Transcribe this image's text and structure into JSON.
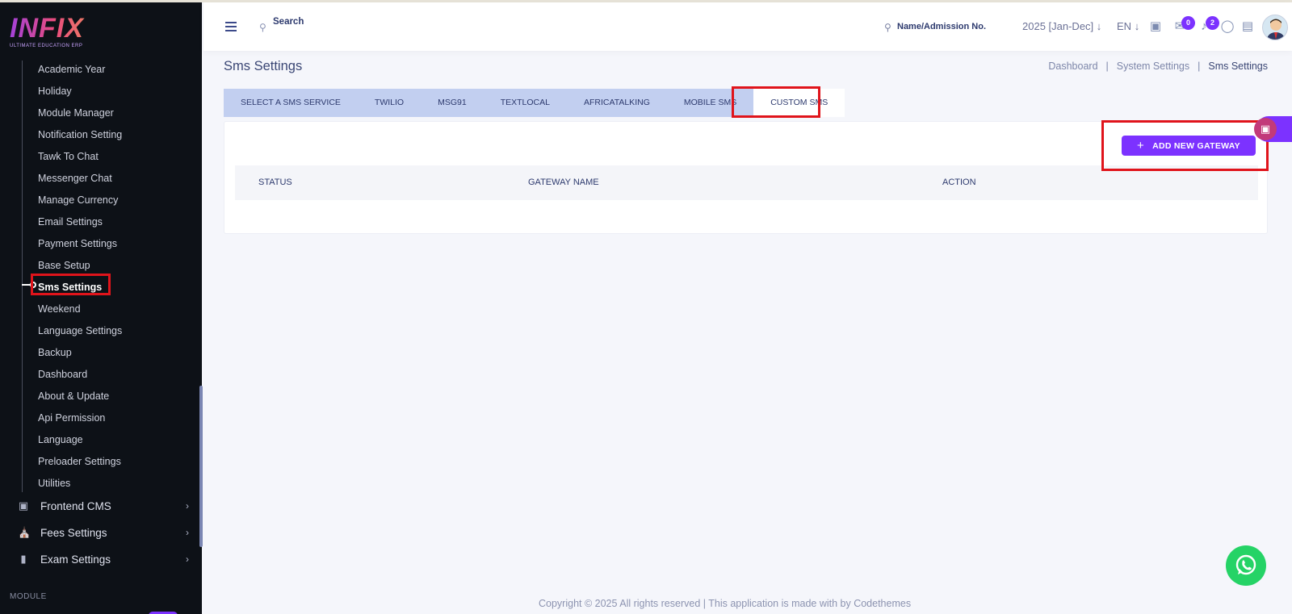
{
  "brand": {
    "name": "INFIX",
    "tagline": "ULTIMATE EDUCATION ERP"
  },
  "sidebar": {
    "submenu": [
      {
        "label": "Academic Year"
      },
      {
        "label": "Holiday"
      },
      {
        "label": "Module Manager"
      },
      {
        "label": "Notification Setting"
      },
      {
        "label": "Tawk To Chat"
      },
      {
        "label": "Messenger Chat"
      },
      {
        "label": "Manage Currency"
      },
      {
        "label": "Email Settings"
      },
      {
        "label": "Payment Settings"
      },
      {
        "label": "Base Setup"
      },
      {
        "label": "Sms Settings"
      },
      {
        "label": "Weekend"
      },
      {
        "label": "Language Settings"
      },
      {
        "label": "Backup"
      },
      {
        "label": "Dashboard"
      },
      {
        "label": "About & Update"
      },
      {
        "label": "Api Permission"
      },
      {
        "label": "Language"
      },
      {
        "label": "Preloader Settings"
      },
      {
        "label": "Utilities"
      }
    ],
    "groups": [
      {
        "label": "Frontend CMS",
        "icon": "monitor-icon"
      },
      {
        "label": "Fees Settings",
        "icon": "bank-icon"
      },
      {
        "label": "Exam Settings",
        "icon": "book-icon"
      }
    ],
    "section_label": "MODULE"
  },
  "header": {
    "search_placeholder": "Search",
    "name_search_placeholder": "Name/Admission No.",
    "academic_year": "2025 [Jan-Dec]",
    "language": "EN",
    "chat_count": "0",
    "notification_count": "2"
  },
  "page": {
    "title": "Sms Settings",
    "breadcrumb": [
      "Dashboard",
      "System Settings",
      "Sms Settings"
    ]
  },
  "tabs": [
    {
      "label": "SELECT A SMS SERVICE"
    },
    {
      "label": "TWILIO"
    },
    {
      "label": "MSG91"
    },
    {
      "label": "TEXTLOCAL"
    },
    {
      "label": "AFRICATALKING"
    },
    {
      "label": "MOBILE SMS"
    },
    {
      "label": "CUSTOM SMS"
    }
  ],
  "active_tab": "CUSTOM SMS",
  "table": {
    "add_button_label": "ADD NEW GATEWAY",
    "columns": [
      "STATUS",
      "GATEWAY NAME",
      "ACTION"
    ],
    "rows": []
  },
  "footer": {
    "text": "Copyright © 2025 All rights reserved | This application is made with by Codethemes"
  },
  "colors": {
    "accent": "#7c32ff",
    "sidebar_bg": "#0d1117",
    "tab_bar_bg": "#c2cff0",
    "highlight": "#e0141b"
  }
}
